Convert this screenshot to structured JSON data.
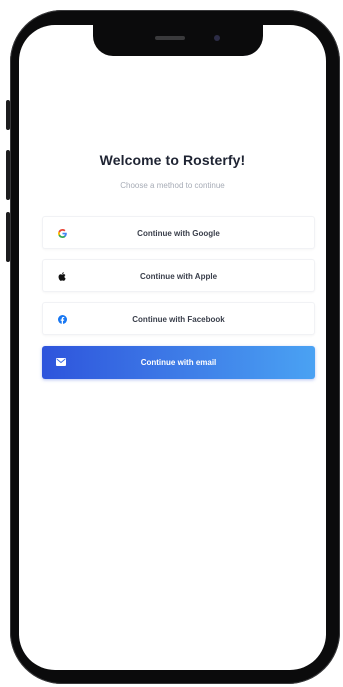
{
  "header": {
    "title": "Welcome to Rosterfy!",
    "subtitle": "Choose a method to continue"
  },
  "methods": [
    {
      "label": "Continue with Google",
      "icon": "google-icon"
    },
    {
      "label": "Continue with Apple",
      "icon": "apple-icon"
    },
    {
      "label": "Continue with Facebook",
      "icon": "facebook-icon"
    },
    {
      "label": "Continue with email",
      "icon": "email-icon"
    }
  ],
  "colors": {
    "primary_gradient_start": "#2e54dc",
    "primary_gradient_end": "#4aa2f3",
    "google_blue": "#4285f4",
    "google_red": "#ea4335",
    "google_yellow": "#fbbc05",
    "google_green": "#34a853",
    "facebook_blue": "#1877f2"
  }
}
